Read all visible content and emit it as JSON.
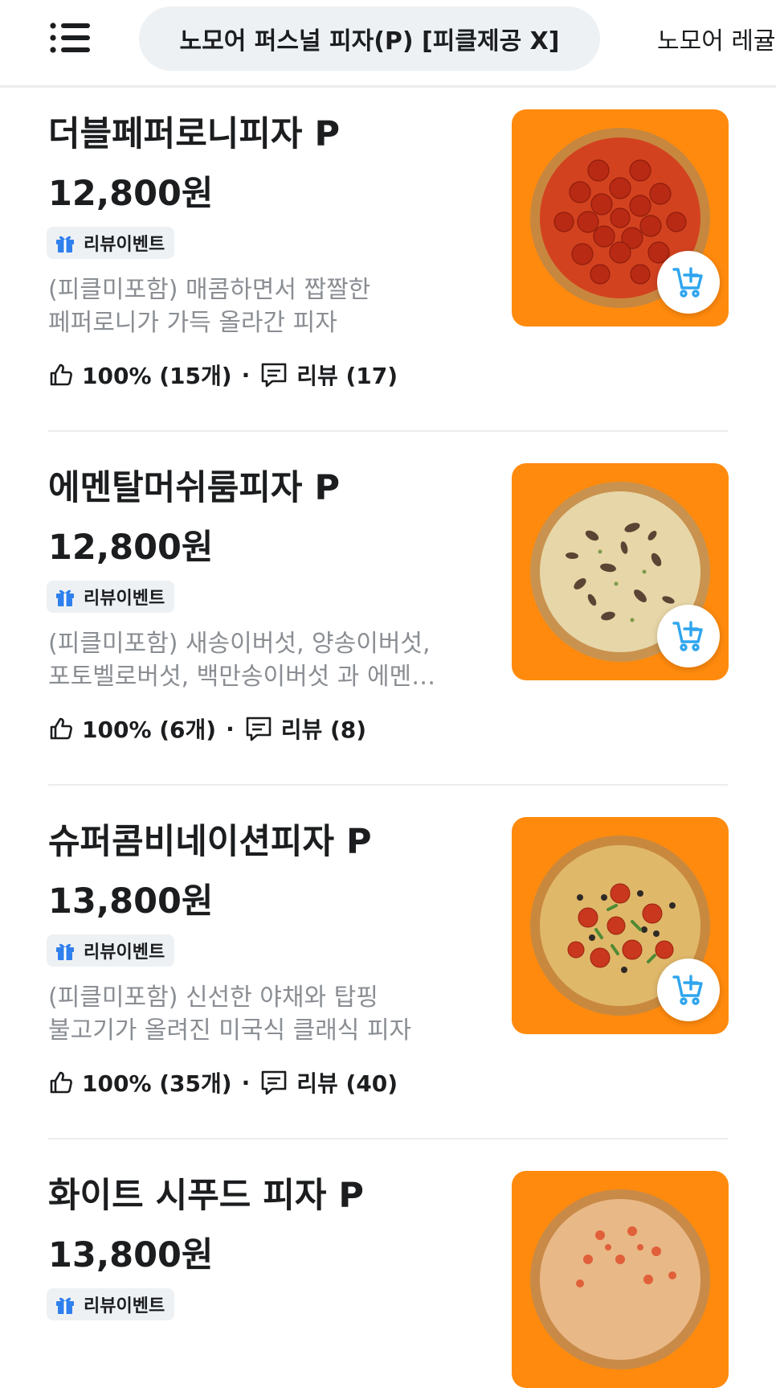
{
  "nav": {
    "menu_icon": "hamburger-menu-icon",
    "active_tab": "노모어 퍼스널 피자(P) [피클제공 X]",
    "next_tab": "노모어 레귤"
  },
  "colors": {
    "thumb_bg": "#ff8a0d",
    "accent_blue": "#2fa5ee",
    "badge_bg": "#eef1f4",
    "desc_gray": "#8a8e93"
  },
  "items": [
    {
      "name": "더블페퍼로니피자 P",
      "price": "12,800원",
      "badge": "리뷰이벤트",
      "desc1": "(피클미포함) 매콤하면서 짭짤한",
      "desc2": "페퍼로니가 가득 올라간 피자",
      "like": "100% (15개)",
      "review": "리뷰 (17)",
      "image": "pepperoni-pizza"
    },
    {
      "name": "에멘탈머쉬룸피자 P",
      "price": "12,800원",
      "badge": "리뷰이벤트",
      "desc1": "(피클미포함) 새송이버섯, 양송이버섯,",
      "desc2": "포토벨로버섯, 백만송이버섯 과 에멘…",
      "like": "100% (6개)",
      "review": "리뷰 (8)",
      "image": "mushroom-pizza"
    },
    {
      "name": "슈퍼콤비네이션피자 P",
      "price": "13,800원",
      "badge": "리뷰이벤트",
      "desc1": "(피클미포함) 신선한 야채와 탑핑",
      "desc2": "불고기가 올려진 미국식 클래식 피자",
      "like": "100% (35개)",
      "review": "리뷰 (40)",
      "image": "combination-pizza"
    },
    {
      "name": "화이트 시푸드 피자 P",
      "price": "13,800원",
      "badge": "리뷰이벤트",
      "image": "seafood-pizza"
    }
  ]
}
